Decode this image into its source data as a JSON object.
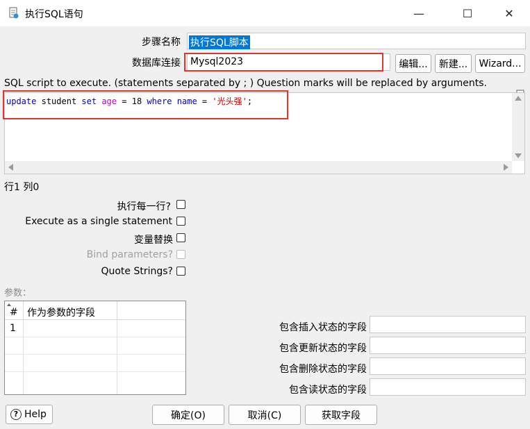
{
  "window": {
    "title": "执行SQL语句",
    "controls": {
      "minimize": "—",
      "maximize": "☐",
      "close": "✕"
    }
  },
  "form": {
    "step_name_label": "步骤名称",
    "step_name_value": "执行SQL脚本",
    "db_conn_label": "数据库连接",
    "db_conn_value": "Mysql2023",
    "edit_button": "编辑...",
    "new_button": "新建...",
    "wizard_button": "Wizard..."
  },
  "sql": {
    "instruction": "SQL script to execute. (statements separated by ; ) Question marks will be replaced by arguments.",
    "tokens": {
      "update": "update",
      "table": "student",
      "set": "set",
      "column": "age",
      "eq1": "=",
      "num": "18",
      "where": "where",
      "field": "name",
      "eq2": "=",
      "str": "'光头强'",
      "semi": ";"
    },
    "position": "行1 列0"
  },
  "options": {
    "execute_each_row": "执行每一行?",
    "single_statement": "Execute as a single statement",
    "variable_substitution": "变量替换",
    "bind_parameters": "Bind parameters?",
    "quote_strings": "Quote Strings?"
  },
  "params": {
    "label": "参数：",
    "col_hash": "#",
    "col_field": "作为参数的字段",
    "rows": [
      "1"
    ]
  },
  "status_fields": {
    "insert": "包含插入状态的字段",
    "update": "包含更新状态的字段",
    "delete": "包含删除状态的字段",
    "read": "包含读状态的字段"
  },
  "footer": {
    "help": "Help",
    "ok": "确定(O)",
    "cancel": "取消(C)",
    "get_fields": "获取字段"
  }
}
